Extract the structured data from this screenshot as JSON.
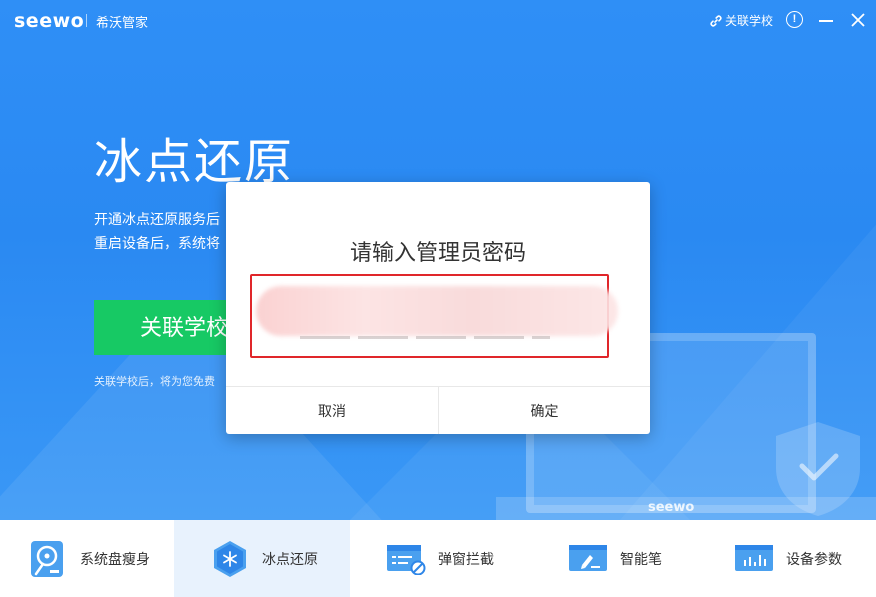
{
  "titlebar": {
    "logo": "seewo",
    "app_name": "希沃管家",
    "link_school_label": "关联学校",
    "info_symbol": "!"
  },
  "hero": {
    "title": "冰点还原",
    "desc_line1": "开通冰点还原服务后",
    "desc_line2": "重启设备后，系统将",
    "button_label": "关联学校",
    "note": "关联学校后，将为您免费"
  },
  "illustration": {
    "laptop_brand": "seewo"
  },
  "modal": {
    "title": "请输入管理员密码",
    "cancel_label": "取消",
    "ok_label": "确定"
  },
  "bottom_nav": {
    "items": [
      {
        "label": "系统盘瘦身",
        "icon": "disk-icon",
        "active": false
      },
      {
        "label": "冰点还原",
        "icon": "snowflake-hexagon-icon",
        "active": true
      },
      {
        "label": "弹窗拦截",
        "icon": "popup-block-icon",
        "active": false
      },
      {
        "label": "智能笔",
        "icon": "smart-pen-icon",
        "active": false
      },
      {
        "label": "设备参数",
        "icon": "device-params-icon",
        "active": false
      }
    ]
  },
  "colors": {
    "hero_blue": "#2f8ff6",
    "green_button": "#17c964",
    "highlight_red": "#e0262a",
    "icon_blue": "#4aa0ef",
    "active_bg": "#e8f2fd"
  }
}
